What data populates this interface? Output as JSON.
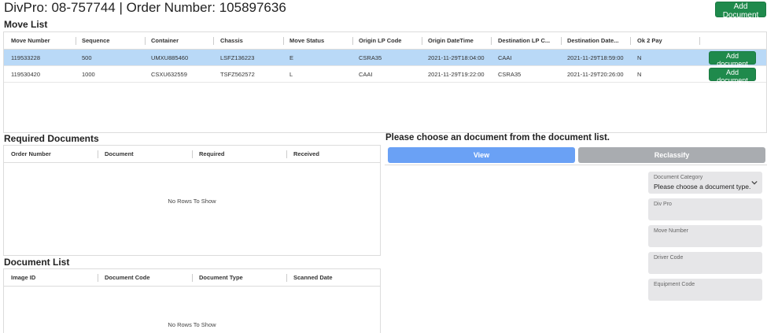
{
  "header": {
    "title": "DivPro: 08-757744 | Order Number: 105897636",
    "add_document_label": "Add Document"
  },
  "move_list": {
    "title": "Move List",
    "columns": [
      "Move Number",
      "Sequence",
      "Container",
      "Chassis",
      "Move Status",
      "Origin LP Code",
      "Origin DateTime",
      "Destination LP C...",
      "Destination Date...",
      "Ok 2 Pay"
    ],
    "rows": [
      {
        "cells": [
          "119533228",
          "500",
          "UMXU885460",
          "LSFZ136223",
          "E",
          "CSRA35",
          "2021-11-29T18:04:00",
          "CAAI",
          "2021-11-29T18:59:00",
          "N"
        ],
        "button": "Add document",
        "selected": true
      },
      {
        "cells": [
          "119530420",
          "1000",
          "CSXU632559",
          "TSFZ562572",
          "L",
          "CAAI",
          "2021-11-29T19:22:00",
          "CSRA35",
          "2021-11-29T20:26:00",
          "N"
        ],
        "button": "Add document",
        "selected": false
      }
    ]
  },
  "required_documents": {
    "title": "Required Documents",
    "columns": [
      "Order Number",
      "Document",
      "Required",
      "Received"
    ],
    "empty_text": "No Rows To Show"
  },
  "document_list": {
    "title": "Document List",
    "columns": [
      "Image ID",
      "Document Code",
      "Document Type",
      "Scanned Date"
    ],
    "empty_text": "No Rows To Show"
  },
  "viewer": {
    "prompt": "Please choose an document from the document list.",
    "view_label": "View",
    "reclassify_label": "Reclassify"
  },
  "form": {
    "document_category": {
      "label": "Document Category",
      "value": "Please choose a document type."
    },
    "div_pro": {
      "label": "Div Pro"
    },
    "move_number": {
      "label": "Move Number"
    },
    "driver_code": {
      "label": "Driver Code"
    },
    "equipment_code": {
      "label": "Equipment Code"
    }
  },
  "colors": {
    "accent_green": "#1f8a4c",
    "view_blue": "#6aa1f5",
    "disabled_gray": "#a9acb0",
    "selected_row": "#b9d9f7"
  }
}
